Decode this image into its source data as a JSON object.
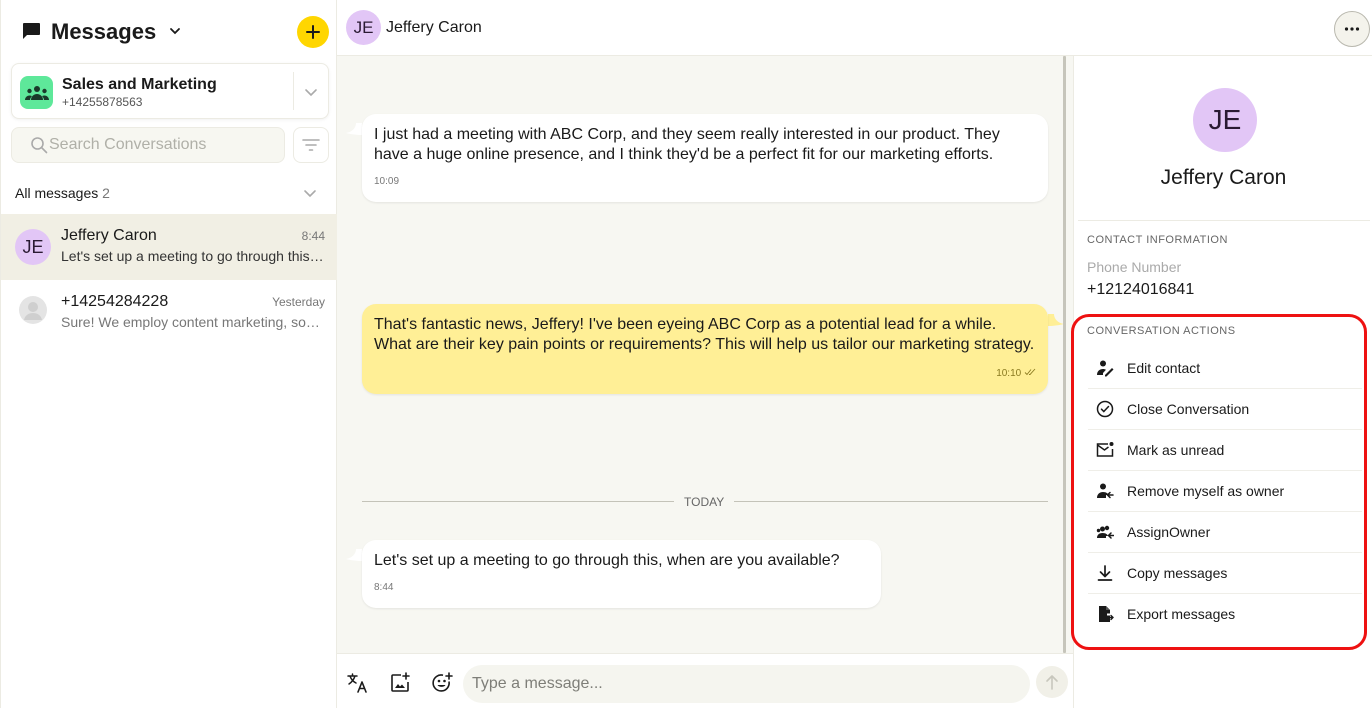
{
  "sidebar": {
    "title": "Messages",
    "inbox": {
      "name": "Sales and Marketing",
      "phone": "+14255878563"
    },
    "search": {
      "placeholder": "Search Conversations",
      "value": ""
    },
    "filter_label": "All messages",
    "filter_count": "2",
    "conversations": [
      {
        "initials": "JE",
        "name": "Jeffery Caron",
        "time": "8:44",
        "preview": "Let's set up a meeting to go through this, when are you available?",
        "active": true
      },
      {
        "initials": "",
        "name": "+14254284228",
        "time": "Yesterday",
        "preview": "Sure! We employ content marketing, social media, and more.",
        "active": false
      }
    ]
  },
  "chat": {
    "header": {
      "initials": "JE",
      "name": "Jeffery Caron"
    },
    "messages": [
      {
        "direction": "in",
        "text": "I just had a meeting with ABC Corp, and they seem really interested in our product. They have a huge online presence, and I think they'd be a perfect fit for our marketing efforts.",
        "time": "10:09"
      },
      {
        "direction": "out",
        "text": "That's fantastic news, Jeffery! I've been eyeing ABC Corp as a potential lead for a while. What are their key pain points or requirements? This will help us tailor our marketing strategy.",
        "time": "10:10",
        "status": "read"
      },
      {
        "direction": "in",
        "text": "Let's set up a meeting to go through this, when are you available?",
        "time": "8:44"
      }
    ],
    "date_separator": "TODAY",
    "composer": {
      "placeholder": "Type a message...",
      "value": ""
    }
  },
  "contact_panel": {
    "initials": "JE",
    "name": "Jeffery Caron",
    "contact_info_label": "CONTACT INFORMATION",
    "phone_label": "Phone Number",
    "phone_value": "+12124016841",
    "actions_label": "CONVERSATION ACTIONS",
    "actions": [
      {
        "icon": "edit-contact-icon",
        "label": "Edit contact"
      },
      {
        "icon": "check-circle-icon",
        "label": "Close Conversation"
      },
      {
        "icon": "mail-unread-icon",
        "label": "Mark as unread"
      },
      {
        "icon": "remove-owner-icon",
        "label": "Remove myself as owner"
      },
      {
        "icon": "assign-owner-icon",
        "label": "AssignOwner"
      },
      {
        "icon": "download-icon",
        "label": "Copy messages"
      },
      {
        "icon": "export-file-icon",
        "label": "Export messages"
      }
    ]
  },
  "colors": {
    "accent_yellow": "#ffd600",
    "outgoing_bubble": "#ffef96",
    "avatar_purple": "#e2c6f6",
    "inbox_green": "#5ee89a",
    "highlight_red": "#ee1111"
  }
}
